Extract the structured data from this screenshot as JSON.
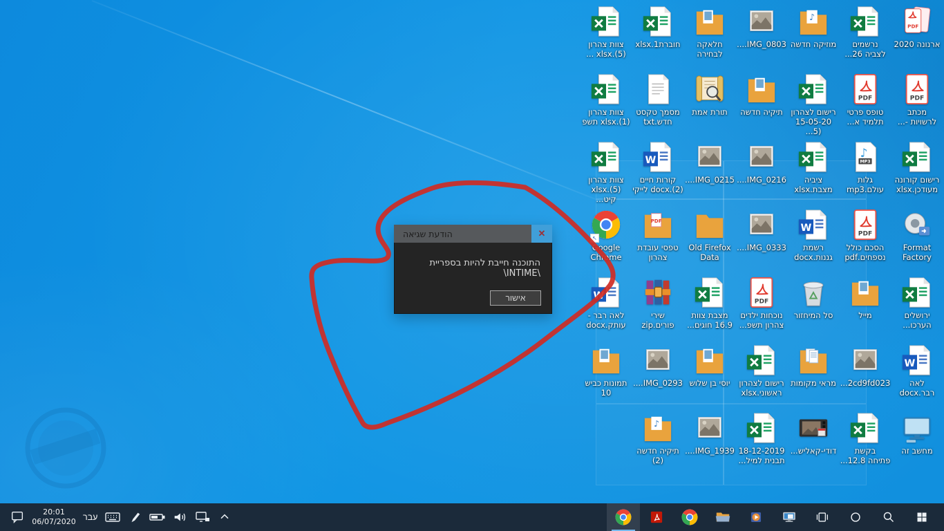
{
  "colors": {
    "wallpaper_base": "#0f93e2",
    "taskbar_bg": "#1b2a3a",
    "annotation_red": "#cf2b24",
    "dialog_title_bg": "#56595c",
    "dialog_body_bg": "#242424",
    "close_button_bg": "#409fd9",
    "active_underline": "#76b9ed"
  },
  "dialog": {
    "title": "הודעת שגיאה",
    "close_icon": "✕",
    "message": "התוכנה חייבת להיות בספריית \\INTIME\\",
    "ok_label": "אישור"
  },
  "desktop": {
    "icons": [
      {
        "label": "ארנונה 2020",
        "type": "pdfstack",
        "col": 1,
        "row": 1
      },
      {
        "label": "נרשמים\nלצביה 26...",
        "type": "excel",
        "col": 2,
        "row": 1
      },
      {
        "label": "מוזיקה חדשה",
        "type": "foldermusic",
        "col": 3,
        "row": 1
      },
      {
        "label": "IMG_0803....",
        "type": "image",
        "col": 4,
        "row": 1
      },
      {
        "label": "חלאקה\nלבחירה",
        "type": "folderimg",
        "col": 5,
        "row": 1
      },
      {
        "label": "חוברת1.xlsx",
        "type": "excel",
        "col": 6,
        "row": 1
      },
      {
        "label": "צוות צהרון\n(5).xlsx ...",
        "type": "excel",
        "col": 7,
        "row": 1
      },
      {
        "label": "מכתב\nלרשויות -...",
        "type": "pdf",
        "col": 1,
        "row": 2
      },
      {
        "label": "טופס פרטי\nתלמיד א...",
        "type": "pdf",
        "col": 2,
        "row": 2
      },
      {
        "label": "רישום לצהרון\n15-05-20 (5...",
        "type": "excel",
        "col": 3,
        "row": 2
      },
      {
        "label": "תיקיה חדשה",
        "type": "folderimg",
        "col": 4,
        "row": 2
      },
      {
        "label": "תורת אמת",
        "type": "torah",
        "col": 5,
        "row": 2
      },
      {
        "label": "מסמך טקסט\nחדש.txt",
        "type": "text",
        "col": 6,
        "row": 2
      },
      {
        "label": "צוות צהרון\n(1).xlsx תשפ",
        "type": "excel",
        "col": 7,
        "row": 2
      },
      {
        "label": "רישום קורונה\nמעודכן.xlsx",
        "type": "excel",
        "col": 1,
        "row": 3
      },
      {
        "label": "גלות\nעולם.mp3",
        "type": "mp3",
        "col": 2,
        "row": 3
      },
      {
        "label": "ציביה\nמצבת.xlsx",
        "type": "excel",
        "col": 3,
        "row": 3
      },
      {
        "label": "IMG_0216....",
        "type": "image",
        "col": 4,
        "row": 3
      },
      {
        "label": "IMG_0215....",
        "type": "image",
        "col": 5,
        "row": 3
      },
      {
        "label": "קורות חיים\n(2).docx לייקי",
        "type": "word",
        "col": 6,
        "row": 3
      },
      {
        "label": "צוות צהרון\n(5).xlsx קיט...",
        "type": "excel",
        "col": 7,
        "row": 3
      },
      {
        "label": "Format\nFactory",
        "type": "ff",
        "col": 1,
        "row": 4
      },
      {
        "label": "הסכם כולל\nנספחים.pdf",
        "type": "pdf",
        "col": 2,
        "row": 4
      },
      {
        "label": "רשמת\nגננות.docx",
        "type": "word",
        "col": 3,
        "row": 4
      },
      {
        "label": "IMG_0333....",
        "type": "image",
        "col": 4,
        "row": 4
      },
      {
        "label": "Old Firefox\nData",
        "type": "folder",
        "col": 5,
        "row": 4
      },
      {
        "label": "טפסי עובדת\nצהרון",
        "type": "folderpdf",
        "col": 6,
        "row": 4
      },
      {
        "label": "Google\nChrome",
        "type": "chrome",
        "col": 7,
        "row": 4
      },
      {
        "label": "ירושלים\nהערכו...",
        "type": "excel",
        "col": 1,
        "row": 5
      },
      {
        "label": "מייל",
        "type": "folderimg",
        "col": 2,
        "row": 5
      },
      {
        "label": "סל המיחזור",
        "type": "bin",
        "col": 3,
        "row": 5
      },
      {
        "label": "נוכחות ילדים\nצהרון תשפ...",
        "type": "pdf",
        "col": 4,
        "row": 5
      },
      {
        "label": "מצבת צוות\n16.9 חוגים...",
        "type": "excel",
        "col": 5,
        "row": 5
      },
      {
        "label": "שירי\nפורים.zip",
        "type": "zip",
        "col": 6,
        "row": 5
      },
      {
        "label": "לאה רבר -\nעותק.docx",
        "type": "word",
        "col": 7,
        "row": 5
      },
      {
        "label": "לאה\nרבר.docx",
        "type": "word",
        "col": 1,
        "row": 6
      },
      {
        "label": "2cd9fd023...",
        "type": "image",
        "col": 2,
        "row": 6
      },
      {
        "label": "מראי מקומות",
        "type": "folderdocs",
        "col": 3,
        "row": 6
      },
      {
        "label": "רישום לצהרון\nראשוני.xlsx",
        "type": "excel",
        "col": 4,
        "row": 6
      },
      {
        "label": "יוסי בן שלוש",
        "type": "folderimg",
        "col": 5,
        "row": 6
      },
      {
        "label": "IMG_0293....",
        "type": "image",
        "col": 6,
        "row": 6
      },
      {
        "label": "תמונות כביש\n10",
        "type": "folderimg",
        "col": 7,
        "row": 6
      },
      {
        "label": "מחשב זה",
        "type": "pc",
        "col": 1,
        "row": 7
      },
      {
        "label": "בקשת\nפתיחה 12.8...",
        "type": "excel",
        "col": 2,
        "row": 7
      },
      {
        "label": "דודי-קאליש...",
        "type": "video",
        "col": 3,
        "row": 7
      },
      {
        "label": "18-12-2019\nתבנית למיל...",
        "type": "excel",
        "col": 4,
        "row": 7
      },
      {
        "label": "IMG_1939....",
        "type": "image",
        "col": 5,
        "row": 7
      },
      {
        "label": "תיקיה חדשה\n(2)",
        "type": "foldermusic",
        "col": 6,
        "row": 7
      }
    ]
  },
  "taskbar": {
    "time": "20:01",
    "date": "06/07/2020",
    "language": "עבר",
    "apps": [
      {
        "type": "chrome",
        "name": "chrome",
        "active": true
      },
      {
        "type": "acrobat",
        "name": "acrobat"
      },
      {
        "type": "chrome",
        "name": "chrome-2"
      },
      {
        "type": "explorer",
        "name": "file-explorer"
      },
      {
        "type": "media",
        "name": "media-player"
      },
      {
        "type": "system",
        "name": "system"
      },
      {
        "type": "taskview",
        "name": "task-view"
      },
      {
        "type": "cortana",
        "name": "cortana"
      },
      {
        "type": "search",
        "name": "search"
      },
      {
        "type": "start",
        "name": "start"
      }
    ]
  }
}
